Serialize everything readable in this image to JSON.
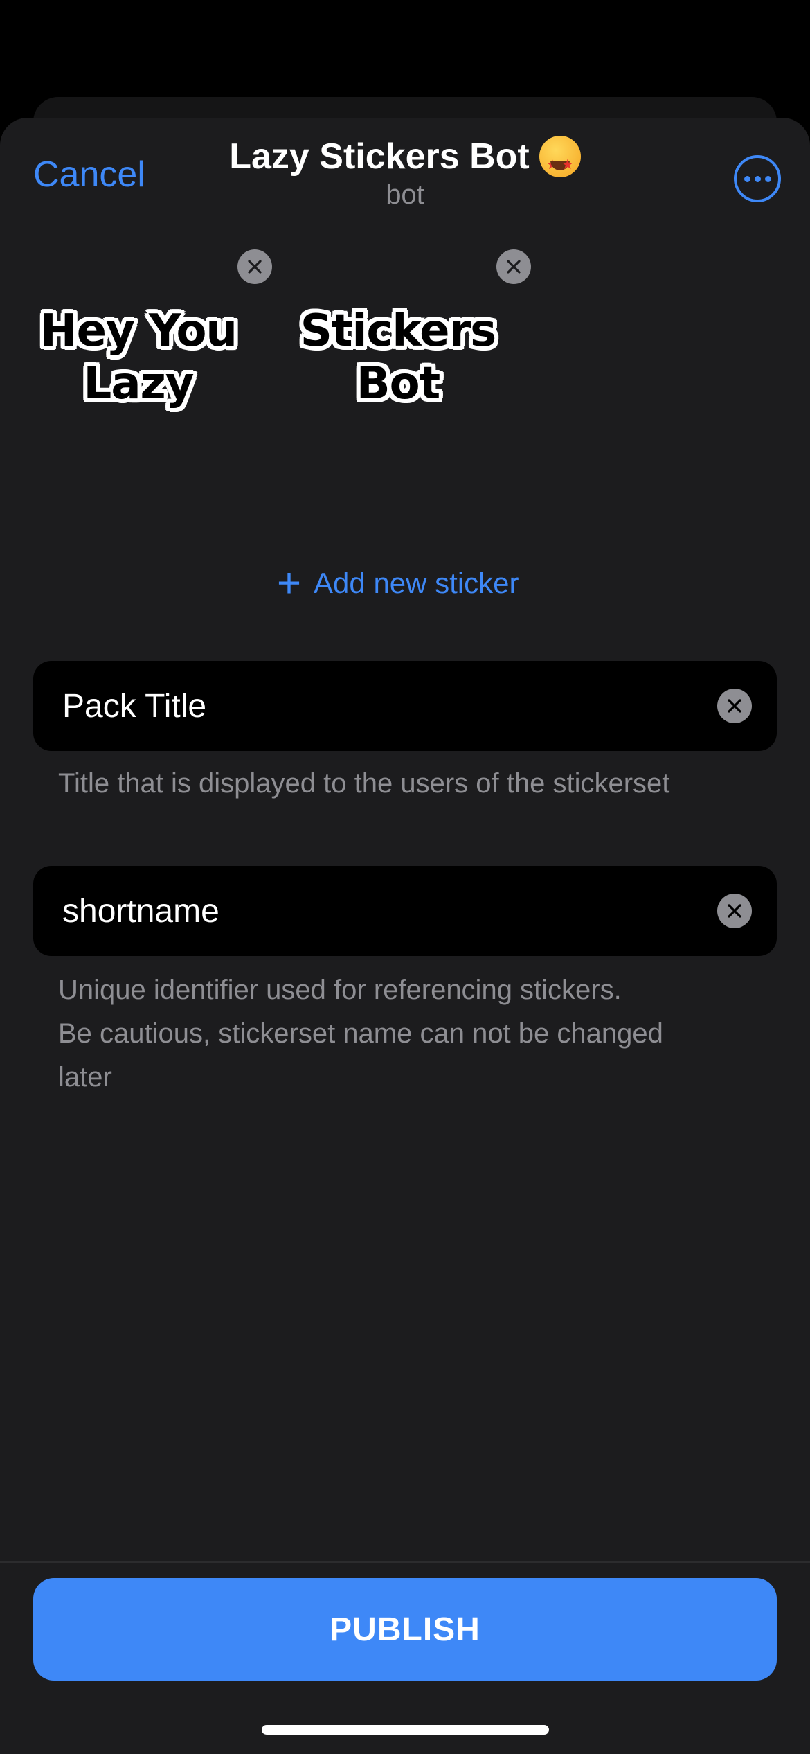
{
  "header": {
    "cancel_label": "Cancel",
    "title": "Lazy Stickers Bot",
    "title_emoji": "star-struck-emoji",
    "subtitle": "bot",
    "more_icon": "ellipsis-circle-icon"
  },
  "stickers": [
    {
      "line1": "Hey You",
      "line2": "Lazy",
      "remove_icon": "close-icon"
    },
    {
      "line1": "Stickers",
      "line2": "Bot",
      "remove_icon": "close-icon"
    }
  ],
  "add_sticker": {
    "icon": "plus-icon",
    "label": "Add new sticker"
  },
  "pack_title": {
    "value": "Pack Title",
    "hint": "Title that is displayed to the users of the stickerset",
    "clear_icon": "clear-icon"
  },
  "shortname": {
    "value": "shortname",
    "hint_line1": "Unique identifier used for referencing stickers.",
    "hint_line2": "Be cautious, stickerset name can not be changed",
    "hint_line3": "later",
    "clear_icon": "clear-icon"
  },
  "publish_label": "PUBLISH",
  "colors": {
    "accent": "#3e88f7",
    "sheet_bg": "#1c1c1e",
    "field_bg": "#000000",
    "secondary_text": "#8e8e93"
  }
}
